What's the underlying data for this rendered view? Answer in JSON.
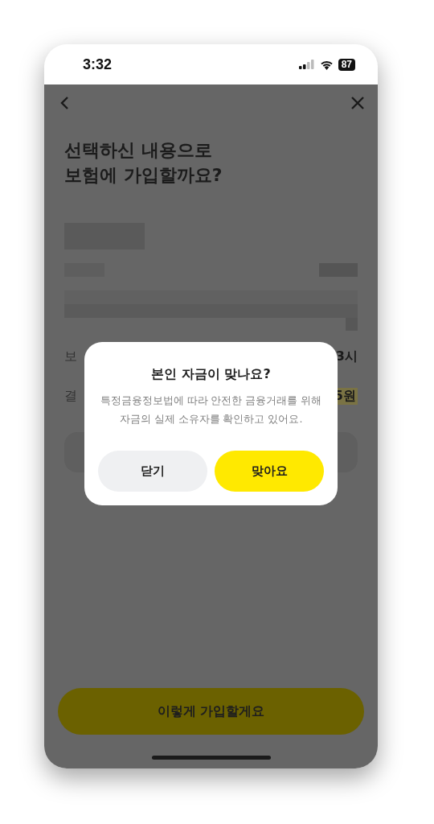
{
  "status_bar": {
    "time": "3:32",
    "battery": "87"
  },
  "title_lines": [
    "선택하신 내용으로",
    "보험에 가입할까요?"
  ],
  "rows": [
    {
      "label": "보",
      "value": "3시",
      "highlight": false
    },
    {
      "label": "결",
      "value": "5원",
      "highlight": true
    }
  ],
  "primary_button": "이렇게 가입할게요",
  "dialog": {
    "title": "본인 자금이 맞나요?",
    "message_lines": [
      "특정금융정보법에 따라 안전한 금융거래를 위해",
      "자금의 실제 소유자를 확인하고 있어요."
    ],
    "buttons": [
      {
        "label": "닫기",
        "kind": "secondary"
      },
      {
        "label": "맞아요",
        "kind": "primary"
      }
    ]
  }
}
